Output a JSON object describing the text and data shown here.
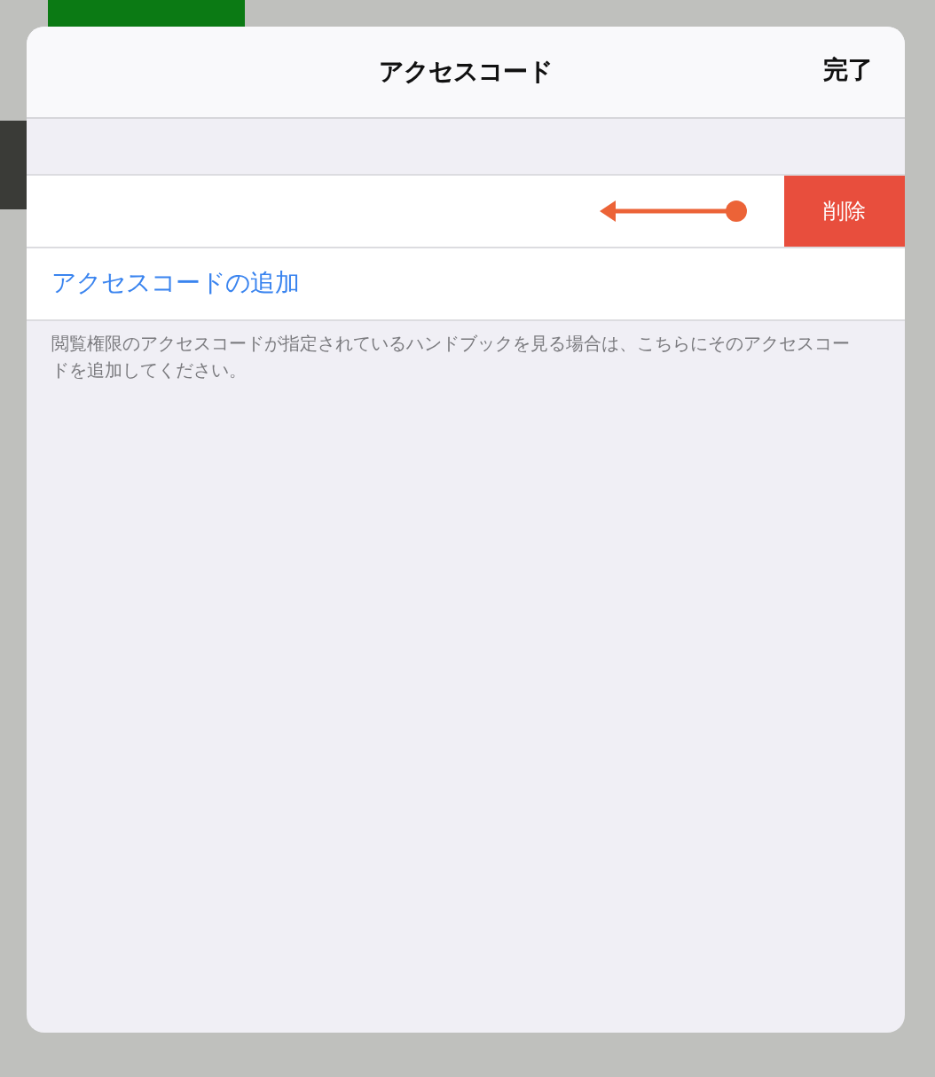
{
  "dialog": {
    "title": "アクセスコード",
    "done_button": "完了"
  },
  "access_code_row": {
    "swipe_hint": true,
    "delete_button": "削除"
  },
  "add_link": "アクセスコードの追加",
  "footer_note": "閲覧権限のアクセスコードが指定されているハンドブックを見る場合は、こちらにそのアクセスコードを追加してください。"
}
